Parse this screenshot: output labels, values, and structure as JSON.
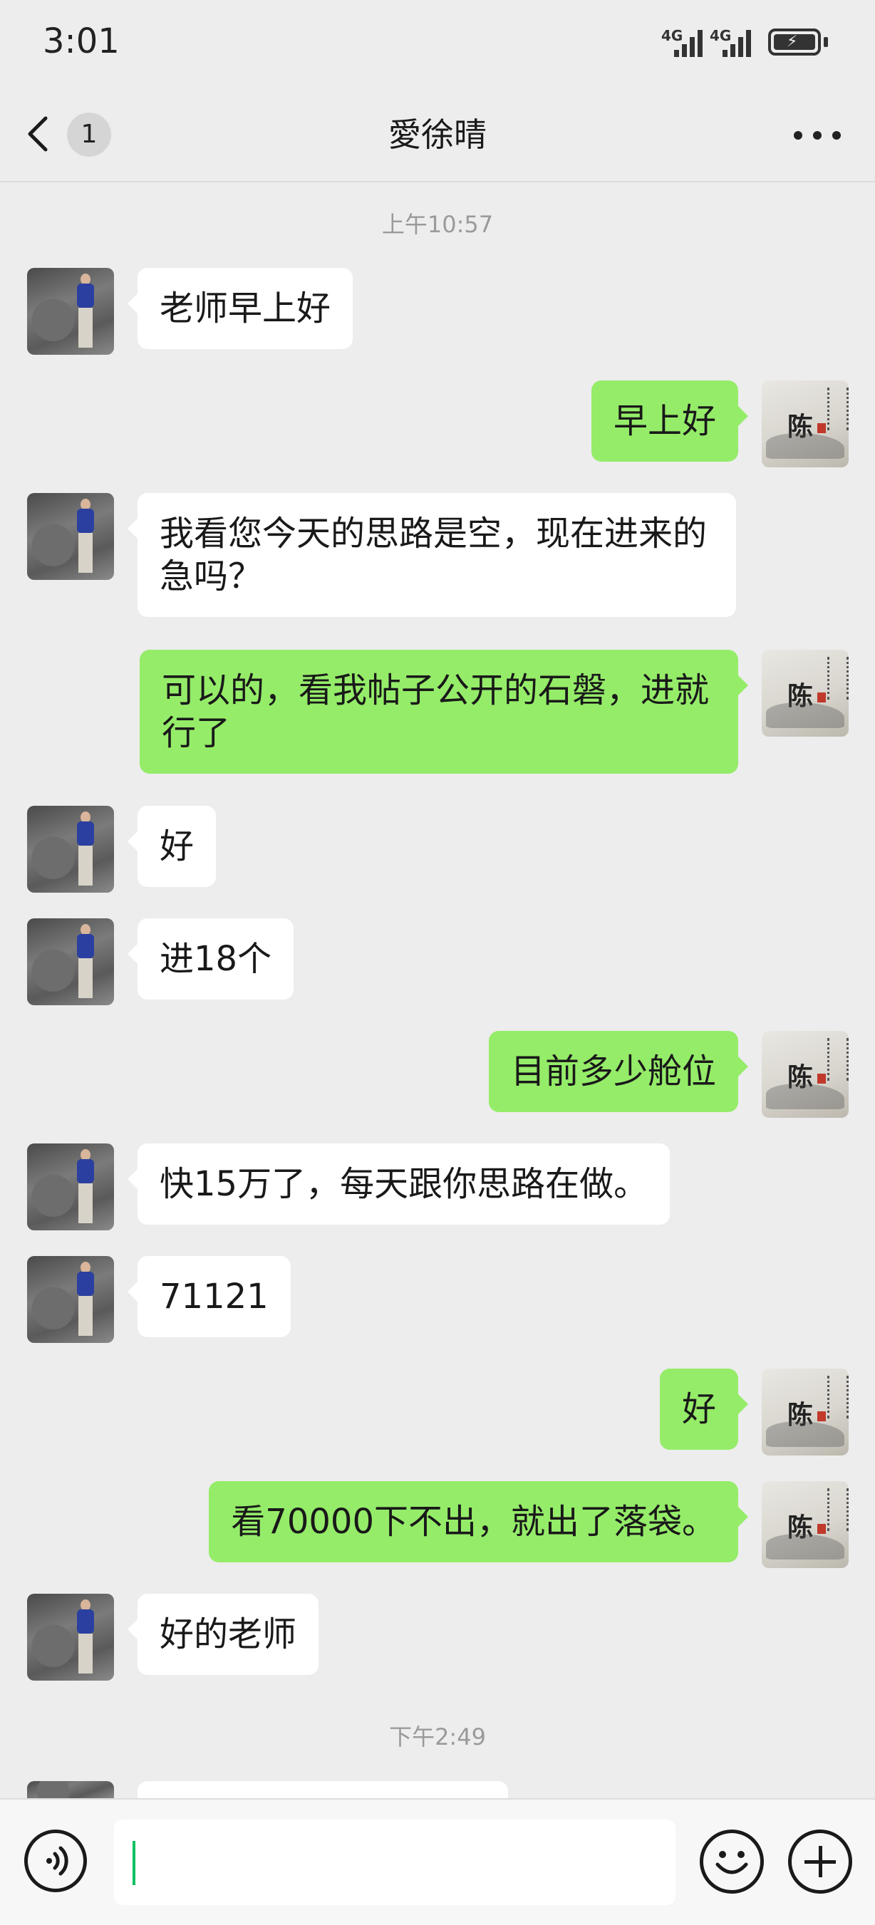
{
  "status_bar": {
    "time": "3:01",
    "network_1": "4G",
    "network_2": "4G",
    "battery_icon": "battery-charging-icon"
  },
  "header": {
    "unread_count": "1",
    "title": "愛徐晴",
    "back_icon": "chevron-left-icon",
    "more_icon": "more-dots-icon"
  },
  "messages": [
    {
      "kind": "timestamp",
      "text": "上午10:57"
    },
    {
      "kind": "msg",
      "side": "left",
      "text": "老师早上好"
    },
    {
      "kind": "msg",
      "side": "right",
      "text": "早上好"
    },
    {
      "kind": "msg",
      "side": "left",
      "text": "我看您今天的思路是空，现在进来的急吗？"
    },
    {
      "kind": "msg",
      "side": "right",
      "text": "可以的，看我帖子公开的石磐，进就行了"
    },
    {
      "kind": "msg",
      "side": "left",
      "text": "好"
    },
    {
      "kind": "msg",
      "side": "left",
      "text": "进18个"
    },
    {
      "kind": "msg",
      "side": "right",
      "text": "目前多少舱位"
    },
    {
      "kind": "msg",
      "side": "left",
      "text": "快15万了，每天跟你思路在做。"
    },
    {
      "kind": "msg",
      "side": "left",
      "text": "71121"
    },
    {
      "kind": "msg",
      "side": "right",
      "text": "好"
    },
    {
      "kind": "msg",
      "side": "right",
      "text": "看70000下不出，就出了落袋。"
    },
    {
      "kind": "msg",
      "side": "left",
      "text": "好的老师"
    },
    {
      "kind": "timestamp",
      "text": "下午2:49"
    }
  ],
  "input_bar": {
    "voice_icon": "voice-icon",
    "emoji_icon": "emoji-icon",
    "plus_icon": "plus-icon",
    "input_value": ""
  },
  "colors": {
    "background": "#EDEDED",
    "own_bubble": "#95EC69",
    "other_bubble": "#FFFFFF",
    "caret": "#07C160"
  }
}
